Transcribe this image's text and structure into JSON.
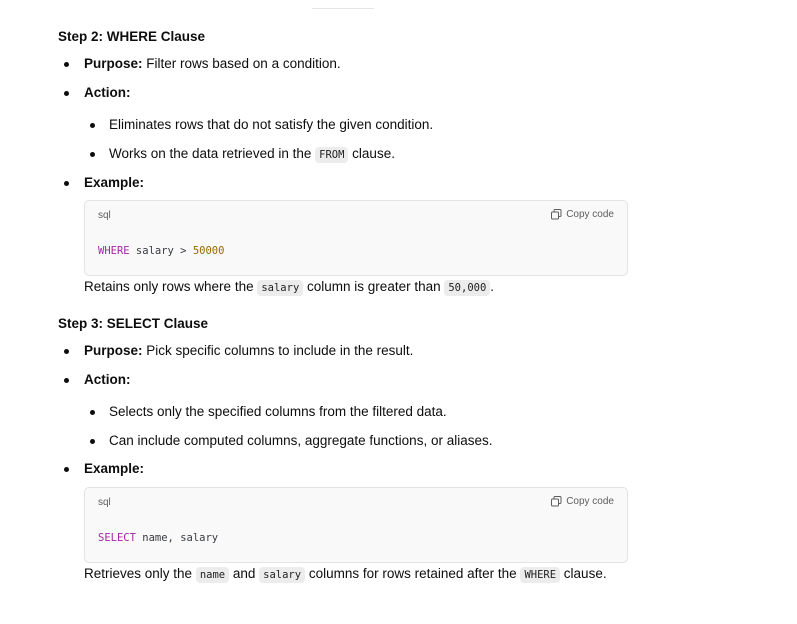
{
  "step2": {
    "heading": "Step 2: WHERE Clause",
    "purpose_label": "Purpose:",
    "purpose_text": " Filter rows based on a condition.",
    "action_label": "Action:",
    "action_items": [
      {
        "text": "Eliminates rows that do not satisfy the given condition."
      },
      {
        "text_before": "Works on the data retrieved in the ",
        "code": "FROM",
        "text_after": " clause."
      }
    ],
    "example_label": "Example:",
    "code_block": {
      "language": "sql",
      "copy_label": "Copy code",
      "keyword": "WHERE",
      "rest": " salary > ",
      "number": "50000"
    },
    "explanation": {
      "before": "Retains only rows where the ",
      "code1": "salary",
      "middle": " column is greater than ",
      "code2": "50,000",
      "after": "."
    }
  },
  "step3": {
    "heading": "Step 3: SELECT Clause",
    "purpose_label": "Purpose:",
    "purpose_text": " Pick specific columns to include in the result.",
    "action_label": "Action:",
    "action_items": [
      {
        "text": "Selects only the specified columns from the filtered data."
      },
      {
        "text": "Can include computed columns, aggregate functions, or aliases."
      }
    ],
    "example_label": "Example:",
    "code_block": {
      "language": "sql",
      "copy_label": "Copy code",
      "keyword": "SELECT",
      "rest": " name, salary"
    },
    "explanation": {
      "before": "Retrieves only the ",
      "code1": "name",
      "middle1": " and ",
      "code2": "salary",
      "middle2": " columns for rows retained after the ",
      "code3": "WHERE",
      "after": " clause."
    }
  },
  "colors": {
    "keyword": "#a626a4",
    "number": "#986801",
    "text": "#0d0d0d"
  },
  "icons": [
    "copy-icon"
  ]
}
